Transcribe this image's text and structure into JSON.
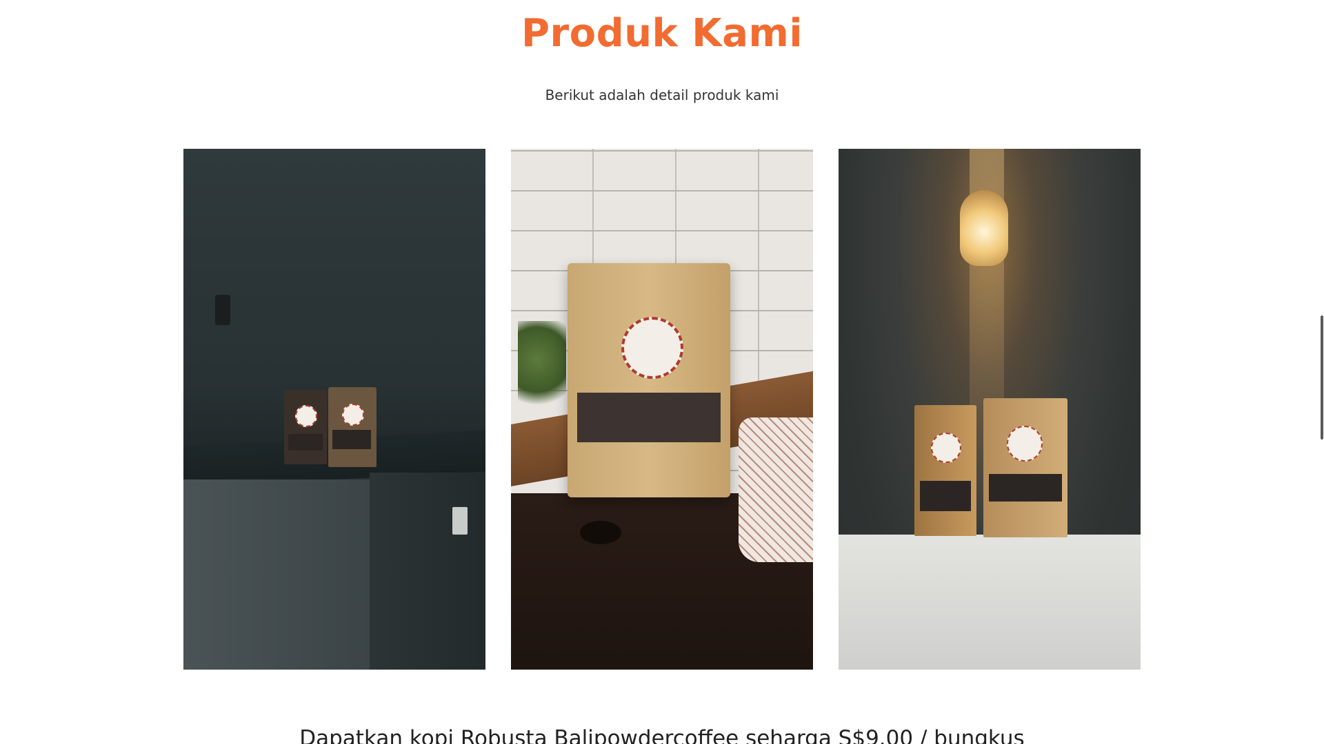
{
  "section": {
    "title": "Produk Kami",
    "subtitle": "Berikut adalah detail produk kami",
    "accent_color": "#f26b30"
  },
  "gallery": {
    "images": [
      {
        "name": "product-photo-wall-ledge"
      },
      {
        "name": "product-photo-kitchen-counter"
      },
      {
        "name": "product-photo-lamp-wall"
      }
    ]
  },
  "offer": {
    "text": "Dapatkan kopi Robusta Balipowdercoffee seharga S$9.00 / bungkus"
  }
}
